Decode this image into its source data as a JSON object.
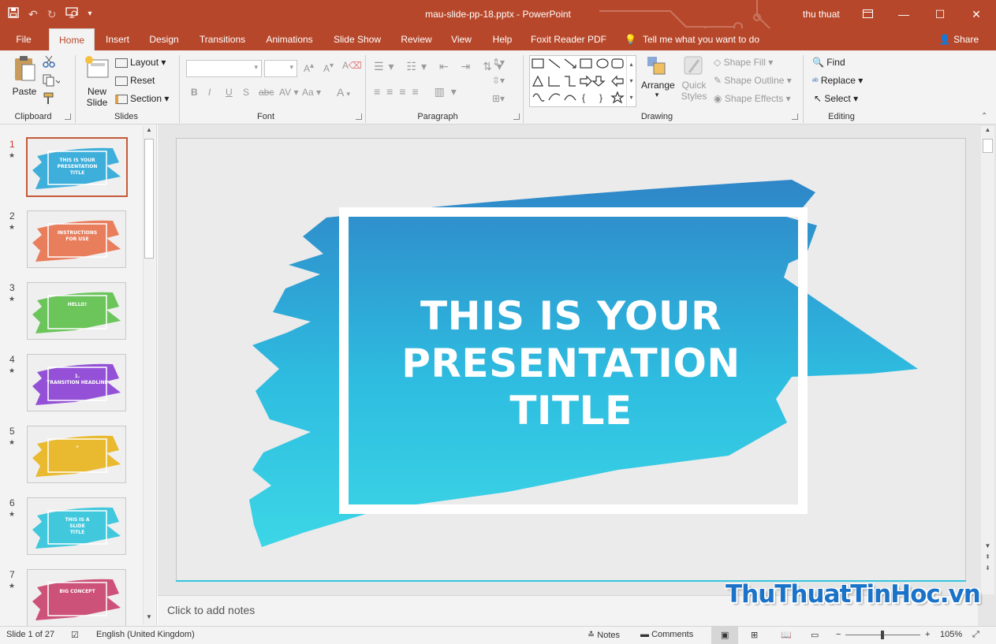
{
  "titlebar": {
    "document_title": "mau-slide-pp-18.pptx - PowerPoint",
    "user_name": "thu thuat"
  },
  "tabs": [
    "File",
    "Home",
    "Insert",
    "Design",
    "Transitions",
    "Animations",
    "Slide Show",
    "Review",
    "View",
    "Help",
    "Foxit Reader PDF"
  ],
  "tell_me": "Tell me what you want to do",
  "share": "Share",
  "ribbon": {
    "clipboard": {
      "label": "Clipboard",
      "paste": "Paste"
    },
    "slides": {
      "label": "Slides",
      "new_slide_1": "New",
      "new_slide_2": "Slide",
      "layout": "Layout",
      "reset": "Reset",
      "section": "Section"
    },
    "font": {
      "label": "Font",
      "bold": "B",
      "italic": "I",
      "underline": "U",
      "shadow": "S",
      "strike": "abc",
      "spacing": "AV",
      "case": "Aa",
      "color": "A"
    },
    "paragraph": {
      "label": "Paragraph"
    },
    "drawing": {
      "label": "Drawing",
      "arrange": "Arrange",
      "quick_styles_1": "Quick",
      "quick_styles_2": "Styles",
      "shape_fill": "Shape Fill",
      "shape_outline": "Shape Outline",
      "shape_effects": "Shape Effects"
    },
    "editing": {
      "label": "Editing",
      "find": "Find",
      "replace": "Replace",
      "select": "Select"
    }
  },
  "thumbnails": [
    {
      "num": "1",
      "color": "#2aa7d8",
      "title": "THIS IS YOUR\nPRESENTATION\nTITLE"
    },
    {
      "num": "2",
      "color": "#e8714b",
      "title": "INSTRUCTIONS\nFOR USE"
    },
    {
      "num": "3",
      "color": "#5cc04a",
      "title": "HELLO!"
    },
    {
      "num": "4",
      "color": "#8a3fd4",
      "title": "1.\nTRANSITION HEADLINE"
    },
    {
      "num": "5",
      "color": "#e8b21a",
      "title": "“"
    },
    {
      "num": "6",
      "color": "#2fc3d9",
      "title": "THIS IS A\nSLIDE\nTITLE"
    },
    {
      "num": "7",
      "color": "#c9406b",
      "title": "BIG CONCEPT"
    }
  ],
  "slide": {
    "title_line1": "THIS IS YOUR",
    "title_line2": "PRESENTATION",
    "title_line3": "TITLE",
    "brush_color_top": "#2f86c8",
    "brush_color_bottom": "#3cd6e6"
  },
  "notes_placeholder": "Click to add notes",
  "status": {
    "slide_count": "Slide 1 of 27",
    "language": "English (United Kingdom)",
    "notes": "Notes",
    "comments": "Comments",
    "zoom": "105%"
  },
  "watermark": "ThuThuatTinHoc.vn",
  "colors": {
    "accent": "#b7472a"
  }
}
